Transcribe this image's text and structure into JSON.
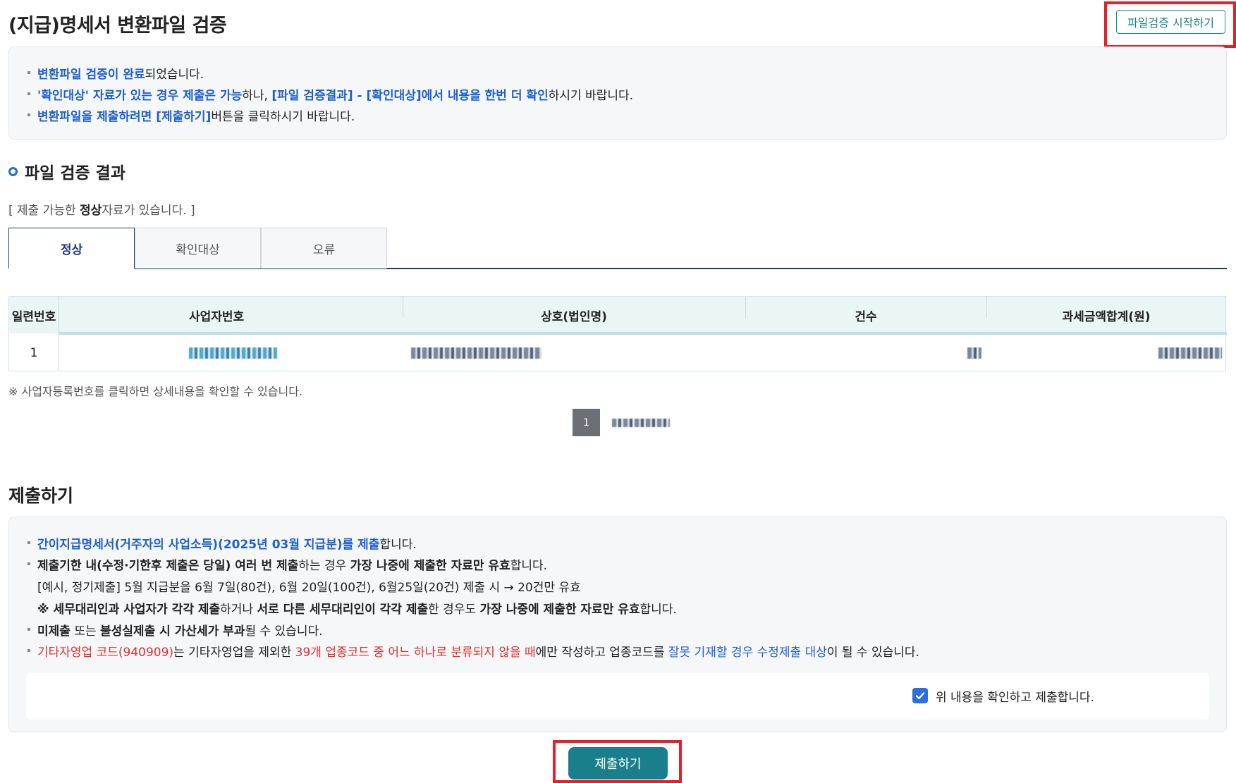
{
  "page": {
    "title": "(지급)명세서 변환파일 검증",
    "start_button": "파일검증 시작하기"
  },
  "notice": {
    "line1": {
      "blue": "변환파일 검증이 완료",
      "rest": "되었습니다."
    },
    "line2": {
      "blue1": "'확인대상' 자료가 있는 경우 제출은 가능",
      "mid": "하나, ",
      "blue2": "[파일 검증결과] - [확인대상]에서 내용을 한번 더 확인",
      "rest": "하시기 바랍니다."
    },
    "line3": {
      "blue": "변환파일을 제출하려면 [제출하기]",
      "rest": "버튼을 클릭하시기 바랍니다."
    }
  },
  "result": {
    "section_title": "파일 검증 결과",
    "msg_prefix": "[ 제출 가능한 ",
    "msg_bold": "정상",
    "msg_suffix": "자료가 있습니다. ]"
  },
  "tabs": [
    "정상",
    "확인대상",
    "오류"
  ],
  "table": {
    "headers": [
      "일련번호",
      "사업자번호",
      "상호(법인명)",
      "건수",
      "과세금액합계(원)"
    ],
    "rows": [
      {
        "serial": "1"
      }
    ]
  },
  "footnote": "※ 사업자등록번호를 클릭하면 상세내용을 확인할 수 있습니다.",
  "pagination": {
    "current": "1"
  },
  "submit": {
    "title": "제출하기",
    "l1": {
      "blue": "간이지급명세서(거주자의 사업소득)(2025년 03월 지급분)를 제출",
      "rest": "합니다."
    },
    "l2": {
      "b1": "제출기한 내(수정·기한후 제출은 당일) 여러 번 제출",
      "m1": "하는 경우 ",
      "b2": "가장 나중에 제출한 자료만 유효",
      "rest": "합니다."
    },
    "l3": "[예시, 정기제출] 5월 지급분을 6월 7일(80건), 6월 20일(100건), 6월25일(20건) 제출 시 → 20건만 유효",
    "l4": {
      "b1": "※ 세무대리인과 사업자가 각각 제출",
      "m1": "하거나 ",
      "b2": "서로 다른 세무대리인이 각각 제출",
      "m2": "한 경우도 ",
      "b3": "가장 나중에 제출한 자료만 유효",
      "rest": "합니다."
    },
    "l5": {
      "b1": "미제출",
      "m1": " 또는 ",
      "b2": "불성실제출 시 가산세가 부과",
      "rest": "될 수 있습니다."
    },
    "l6": {
      "r1": "기타자영업 코드(940909)",
      "m1": "는 기타자영업을 제외한 ",
      "r2": "39개 업종코드 중 어느 하나로 분류되지 않을 때",
      "m2": "에만 작성하고 업종코드를 ",
      "bl": "잘못 기재할 경우 수정제출 대상",
      "rest": "이 될 수 있습니다."
    },
    "confirm_label": "위 내용을 확인하고 제출합니다.",
    "confirm_checked": true,
    "button": "제출하기"
  },
  "colors": {
    "accent": "#1a7f8c",
    "link_blue": "#1e5fd0",
    "warning_red": "#e03030",
    "highlight": "#e3212b"
  }
}
